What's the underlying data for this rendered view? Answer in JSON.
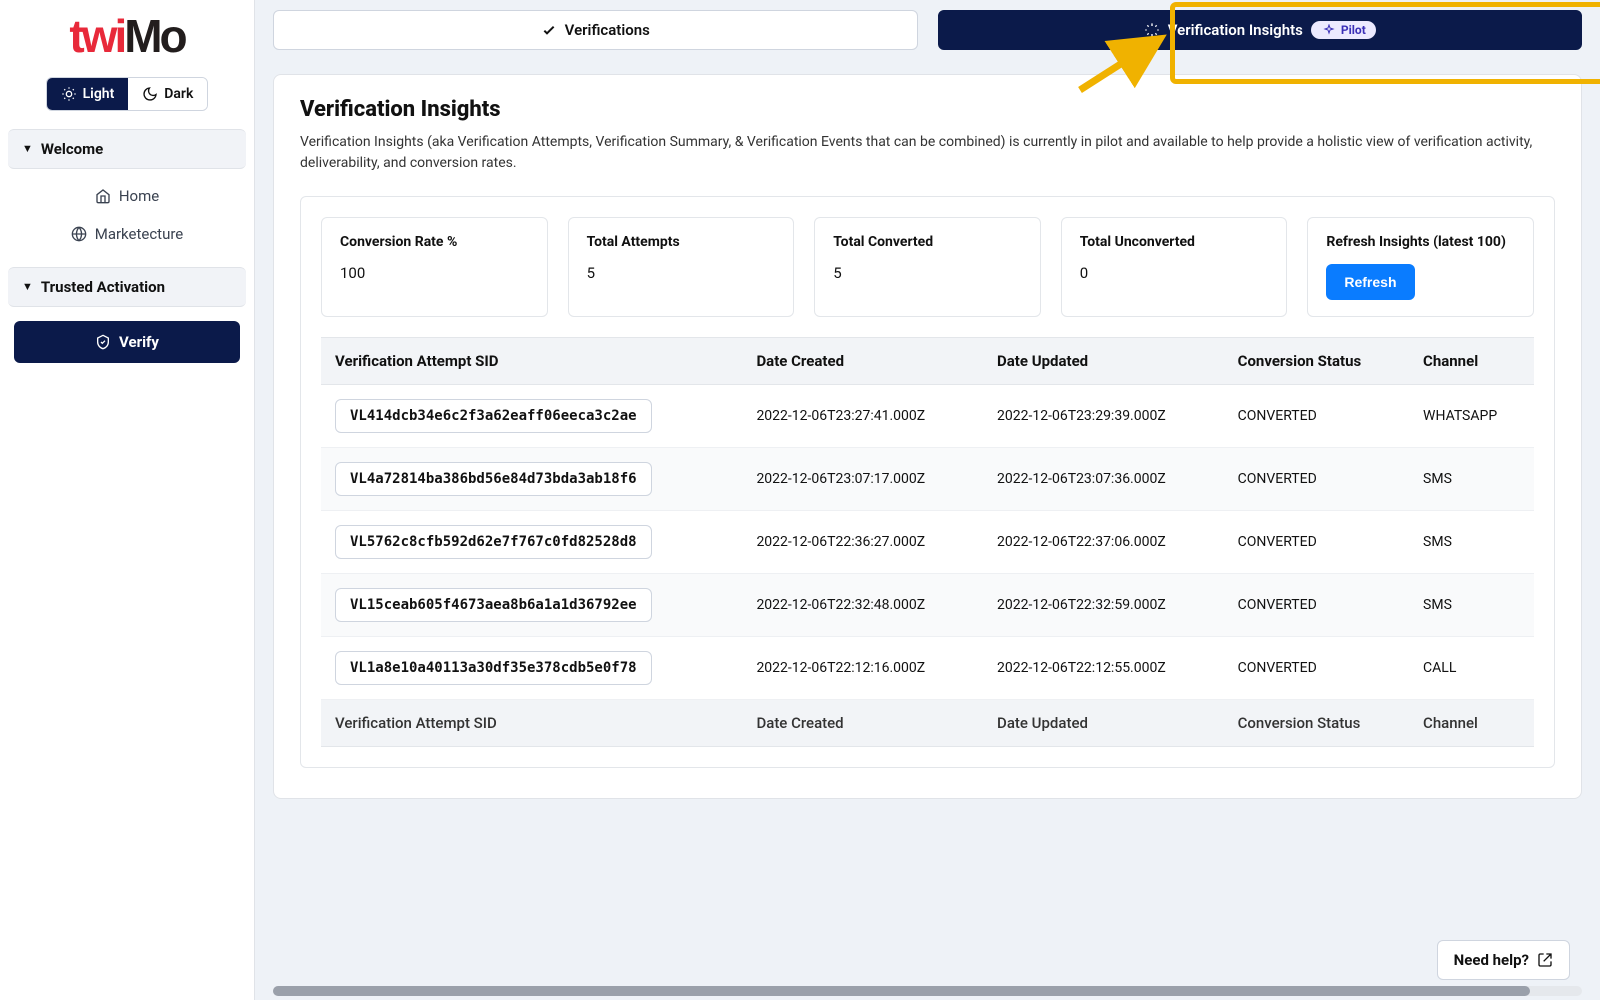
{
  "brand": {
    "part1": "twi",
    "part2": "Mo"
  },
  "theme": {
    "light_label": "Light",
    "dark_label": "Dark"
  },
  "sidebar": {
    "welcome_label": "Welcome",
    "home_label": "Home",
    "marketecture_label": "Marketecture",
    "trusted_activation_label": "Trusted Activation",
    "verify_label": "Verify"
  },
  "tabs": {
    "verifications_label": "Verifications",
    "insights_label": "Verification Insights",
    "pilot_badge": "Pilot"
  },
  "page": {
    "title": "Verification Insights",
    "description": "Verification Insights (aka Verification Attempts, Verification Summary, & Verification Events that can be combined) is currently in pilot and available to help provide a holistic view of verification activity, deliverability, and conversion rates."
  },
  "stats": {
    "conversion_rate": {
      "label": "Conversion Rate %",
      "value": "100"
    },
    "total_attempts": {
      "label": "Total Attempts",
      "value": "5"
    },
    "total_converted": {
      "label": "Total Converted",
      "value": "5"
    },
    "total_unconverted": {
      "label": "Total Unconverted",
      "value": "0"
    },
    "refresh": {
      "label": "Refresh Insights (latest 100)",
      "button": "Refresh"
    }
  },
  "table": {
    "columns": {
      "sid": "Verification Attempt SID",
      "created": "Date Created",
      "updated": "Date Updated",
      "status": "Conversion Status",
      "channel": "Channel"
    },
    "rows": [
      {
        "sid": "VL414dcb34e6c2f3a62eaff06eeca3c2ae",
        "created": "2022-12-06T23:27:41.000Z",
        "updated": "2022-12-06T23:29:39.000Z",
        "status": "CONVERTED",
        "channel": "WHATSAPP"
      },
      {
        "sid": "VL4a72814ba386bd56e84d73bda3ab18f6",
        "created": "2022-12-06T23:07:17.000Z",
        "updated": "2022-12-06T23:07:36.000Z",
        "status": "CONVERTED",
        "channel": "SMS"
      },
      {
        "sid": "VL5762c8cfb592d62e7f767c0fd82528d8",
        "created": "2022-12-06T22:36:27.000Z",
        "updated": "2022-12-06T22:37:06.000Z",
        "status": "CONVERTED",
        "channel": "SMS"
      },
      {
        "sid": "VL15ceab605f4673aea8b6a1a1d36792ee",
        "created": "2022-12-06T22:32:48.000Z",
        "updated": "2022-12-06T22:32:59.000Z",
        "status": "CONVERTED",
        "channel": "SMS"
      },
      {
        "sid": "VL1a8e10a40113a30df35e378cdb5e0f78",
        "created": "2022-12-06T22:12:16.000Z",
        "updated": "2022-12-06T22:12:55.000Z",
        "status": "CONVERTED",
        "channel": "CALL"
      }
    ]
  },
  "help": {
    "label": "Need help?"
  },
  "colors": {
    "navy": "#0b1a4a",
    "blue": "#0a7cff",
    "highlight": "#f0b200",
    "red": "#e8293a"
  }
}
